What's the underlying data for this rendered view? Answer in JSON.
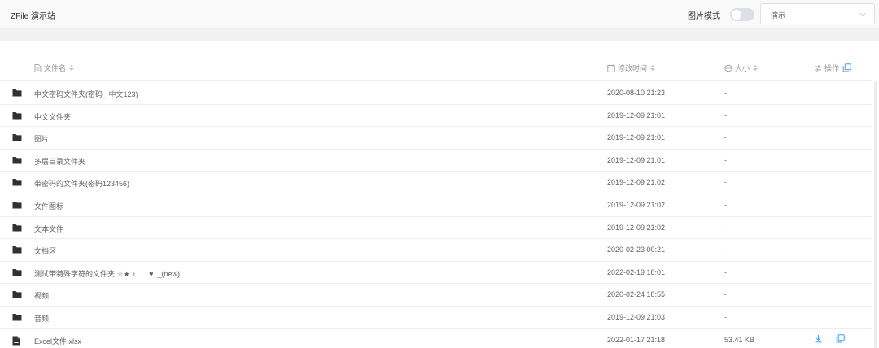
{
  "header": {
    "brand": "ZFile 演示站",
    "image_mode_label": "图片模式",
    "image_mode_on": false,
    "drive_select": {
      "value": "演示",
      "icon": "chevron-down-icon"
    }
  },
  "table": {
    "columns": {
      "name": "文件名",
      "time": "修改时间",
      "size": "大小",
      "actions": "操作"
    },
    "rows": [
      {
        "type": "folder",
        "name": "中文密码文件夹(密码_ 中文123)",
        "time": "2020-08-10 21:23",
        "size": "-"
      },
      {
        "type": "folder",
        "name": "中文文件夹",
        "time": "2019-12-09 21:01",
        "size": "-"
      },
      {
        "type": "folder",
        "name": "图片",
        "time": "2019-12-09 21:01",
        "size": "-"
      },
      {
        "type": "folder",
        "name": "多层目录文件夹",
        "time": "2019-12-09 21:01",
        "size": "-"
      },
      {
        "type": "folder",
        "name": "带密码的文件夹(密码123456)",
        "time": "2019-12-09 21:02",
        "size": "-"
      },
      {
        "type": "folder",
        "name": "文件图标",
        "time": "2019-12-09 21:02",
        "size": "-"
      },
      {
        "type": "folder",
        "name": "文本文件",
        "time": "2019-12-09 21:02",
        "size": "-"
      },
      {
        "type": "folder",
        "name": "文档区",
        "time": "2020-02-23 00:21",
        "size": "-"
      },
      {
        "type": "folder",
        "name": "测试带特殊字符的文件夹 ☆★ ♪ …. ♥ ._(new)",
        "time": "2022-02-19 18:01",
        "size": "-"
      },
      {
        "type": "folder",
        "name": "视频",
        "time": "2020-02-24 18:55",
        "size": "-"
      },
      {
        "type": "folder",
        "name": "音频",
        "time": "2019-12-09 21:03",
        "size": "-"
      },
      {
        "type": "file",
        "name": "Excel文件.xlsx",
        "time": "2022-01-17 21:18",
        "size": "53.41 KB"
      }
    ]
  },
  "colors": {
    "accent": "#409eff",
    "folder": "#303133",
    "border": "#ebeef5"
  }
}
